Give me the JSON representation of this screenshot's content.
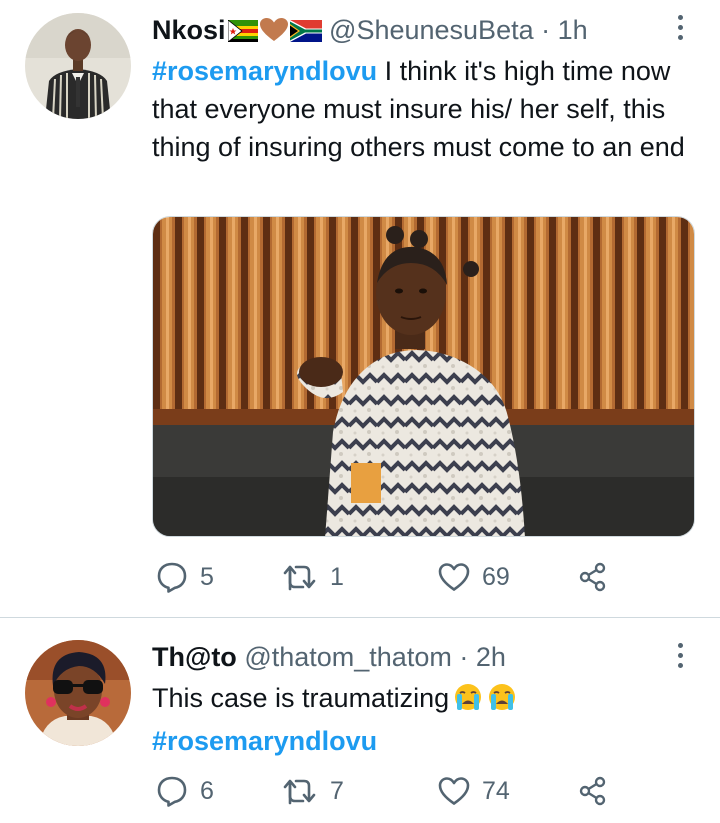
{
  "tweets": [
    {
      "display_name": "Nkosi",
      "handle": "@SheunesuBeta",
      "time": "· 1h",
      "name_emojis": [
        "zimbabwe-flag",
        "brown-heart",
        "south-africa-flag"
      ],
      "hashtag": "#rosemaryndlovu",
      "text": " I think it's high time now that everyone must insure his/ her self, this thing of insuring  others must come to an end",
      "has_image": true,
      "replies": "5",
      "retweets": "1",
      "likes": "69"
    },
    {
      "display_name": "Th@to",
      "handle": "@thatom_thatom",
      "time": "· 2h",
      "text": "This case is traumatizing",
      "text_emojis": [
        "loudly-crying-face",
        "loudly-crying-face"
      ],
      "hashtag": "#rosemaryndlovu",
      "replies": "6",
      "retweets": "7",
      "likes": "74"
    }
  ],
  "colors": {
    "hashtag": "#1d9bf0",
    "meta_text": "#536471",
    "primary_text": "#0f1419",
    "divider": "#cfd9de"
  },
  "icons": [
    "reply-icon",
    "retweet-icon",
    "like-icon",
    "share-icon",
    "more-options-icon"
  ]
}
